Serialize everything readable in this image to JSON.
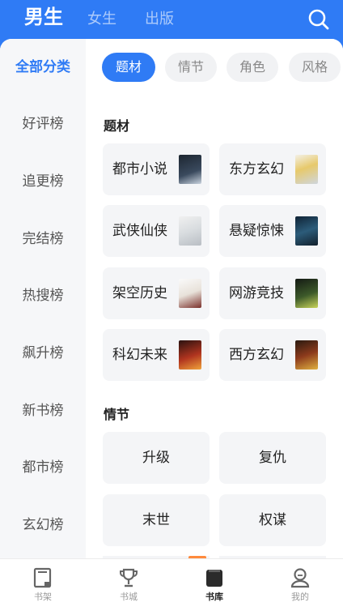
{
  "top_tabs": [
    {
      "label": "男生"
    },
    {
      "label": "女生"
    },
    {
      "label": "出版"
    }
  ],
  "sidebar": {
    "items": [
      {
        "label": "全部分类"
      },
      {
        "label": "好评榜"
      },
      {
        "label": "追更榜"
      },
      {
        "label": "完结榜"
      },
      {
        "label": "热搜榜"
      },
      {
        "label": "飙升榜"
      },
      {
        "label": "新书榜"
      },
      {
        "label": "都市榜"
      },
      {
        "label": "玄幻榜"
      }
    ]
  },
  "chips": [
    {
      "label": "题材"
    },
    {
      "label": "情节"
    },
    {
      "label": "角色"
    },
    {
      "label": "风格"
    }
  ],
  "sections": {
    "theme": {
      "title": "题材",
      "items": [
        {
          "label": "都市小说"
        },
        {
          "label": "东方玄幻"
        },
        {
          "label": "武侠仙侠"
        },
        {
          "label": "悬疑惊悚"
        },
        {
          "label": "架空历史"
        },
        {
          "label": "网游竞技"
        },
        {
          "label": "科幻未来"
        },
        {
          "label": "西方玄幻"
        }
      ]
    },
    "plot": {
      "title": "情节",
      "items": [
        {
          "label": "升级"
        },
        {
          "label": "复仇"
        },
        {
          "label": "末世"
        },
        {
          "label": "权谋"
        }
      ]
    }
  },
  "bottom_nav": [
    {
      "label": "书架",
      "icon": "bookshelf-icon"
    },
    {
      "label": "书城",
      "icon": "trophy-icon"
    },
    {
      "label": "书库",
      "icon": "library-icon"
    },
    {
      "label": "我的",
      "icon": "profile-icon"
    }
  ],
  "colors": {
    "accent": "#2f7bf5",
    "card_bg": "#f4f5f7",
    "sidebar_bg": "#f6f7f9"
  }
}
